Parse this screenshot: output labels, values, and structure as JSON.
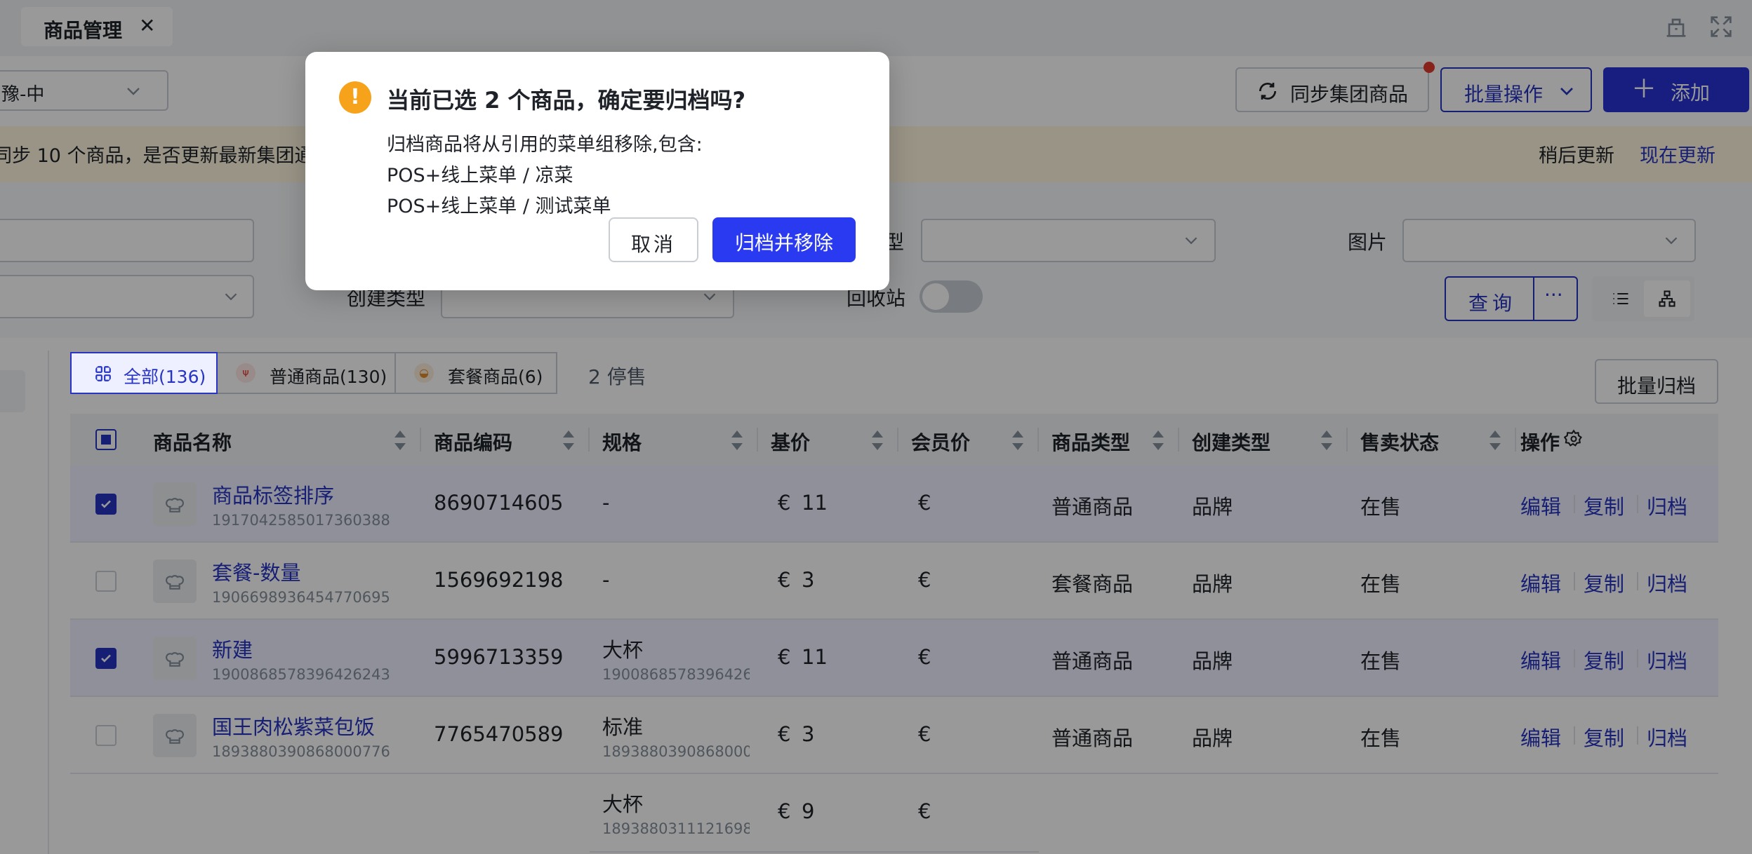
{
  "tab": {
    "title": "商品管理",
    "close": "✕"
  },
  "toolbar": {
    "store_select": "豫-中",
    "sync_label": "同步集团商品",
    "batch_label": "批量操作",
    "add_icon": "＋",
    "add_label": "添加"
  },
  "notice": {
    "text": "同步 10 个商品，是否更新最新集团通",
    "later": "稍后更新",
    "now": "现在更新"
  },
  "filters": {
    "type_label": "型",
    "image_label": "图片",
    "create_type_label": "创建类型",
    "recycle_label": "回收站",
    "recycle_on": false,
    "query_label": "查询",
    "more_label": "···"
  },
  "type_tabs": [
    {
      "label": "全部(136)",
      "icon": "grid-icon",
      "active": true
    },
    {
      "label": "普通商品(130)",
      "icon": "utensils-icon",
      "active": false
    },
    {
      "label": "套餐商品(6)",
      "icon": "meal-icon",
      "active": false
    }
  ],
  "stopped_count": "2 停售",
  "batch_archive_label": "批量归档",
  "table": {
    "columns": [
      "商品名称",
      "商品编码",
      "规格",
      "基价",
      "会员价",
      "商品类型",
      "创建类型",
      "售卖状态",
      "操作"
    ],
    "actions": [
      "编辑",
      "复制",
      "归档"
    ],
    "rows": [
      {
        "selected": true,
        "name": "商品标签排序",
        "id": "1917042585017360388",
        "code": "8690714605",
        "spec": "-",
        "spec_id": "",
        "price_sym": "€",
        "price": "11",
        "member_price": "€",
        "type": "普通商品",
        "create_type": "品牌",
        "status": "在售"
      },
      {
        "selected": false,
        "name": "套餐-数量",
        "id": "1906698936454770695",
        "code": "1569692198",
        "spec": "-",
        "spec_id": "",
        "price_sym": "€",
        "price": "3",
        "member_price": "€",
        "type": "套餐商品",
        "create_type": "品牌",
        "status": "在售"
      },
      {
        "selected": true,
        "name": "新建",
        "id": "1900868578396426243",
        "code": "5996713359",
        "spec": "大杯",
        "spec_id": "19008685783964262",
        "price_sym": "€",
        "price": "11",
        "member_price": "€",
        "type": "普通商品",
        "create_type": "品牌",
        "status": "在售"
      },
      {
        "selected": false,
        "name": "国王肉松紫菜包饭",
        "id": "1893880390868000776",
        "code": "7765470589",
        "spec": "标准",
        "spec_id": "18938803908680007",
        "price_sym": "€",
        "price": "3",
        "member_price": "€",
        "type": "普通商品",
        "create_type": "品牌",
        "status": "在售"
      }
    ],
    "sub_row": {
      "spec": "大杯",
      "spec_id": "18938803111216988",
      "price_sym": "€",
      "price": "9",
      "member_price": "€"
    }
  },
  "dialog": {
    "icon": "!",
    "title": "当前已选 2 个商品，确定要归档吗?",
    "line1": "归档商品将从引用的菜单组移除,包含:",
    "line2": "POS+线上菜单 / 凉菜",
    "line3": "POS+线上菜单 / 测试菜单",
    "cancel": "取消",
    "confirm": "归档并移除"
  },
  "colors": {
    "accent": "#2734c4",
    "primary_button": "#2a3af0",
    "warning": "#f7a21b",
    "notice_bg": "#fff7e0"
  }
}
